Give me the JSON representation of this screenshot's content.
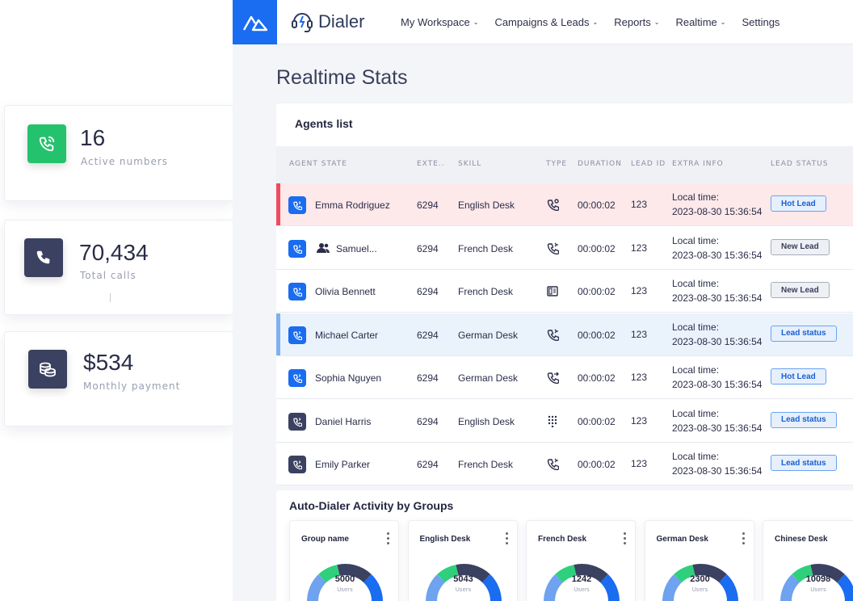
{
  "stats": [
    {
      "value": "16",
      "label": "Active numbers",
      "icon": "phone-call-icon",
      "color": "#25c26e"
    },
    {
      "value": "70,434",
      "label": "Total calls",
      "icon": "phone-icon",
      "color": "#3b4160"
    },
    {
      "value": "$534",
      "label": "Monthly payment",
      "icon": "coins-icon",
      "color": "#3b4160"
    }
  ],
  "brand": {
    "name": "Dialer",
    "accent": "#1a6cf0"
  },
  "nav": [
    {
      "label": "My Workspace",
      "dropdown": true
    },
    {
      "label": "Campaigns & Leads",
      "dropdown": true
    },
    {
      "label": "Reports",
      "dropdown": true
    },
    {
      "label": "Realtime",
      "dropdown": true
    },
    {
      "label": "Settings",
      "dropdown": false
    }
  ],
  "page_title": "Realtime Stats",
  "agents": {
    "title": "Agents list",
    "columns": [
      "AGENT STATE",
      "EXTE..",
      "SKILL",
      "TYPE",
      "DURATION",
      "LEAD ID",
      "EXTRA INFO",
      "LEAD STATUS"
    ],
    "rows": [
      {
        "name": "Emma Rodriguez",
        "ext": "6294",
        "skill": "English Desk",
        "type_icon": "phone-incoming-icon",
        "duration": "00:00:02",
        "lead_id": "123",
        "extra_label": "Local time:",
        "extra_value": "2023-08-30 15:36:54",
        "status": "Hot Lead",
        "status_style": "blue",
        "highlight": "red",
        "icon_color": "#1a6cf0"
      },
      {
        "name": "Samuel...",
        "ext": "6294",
        "skill": "French Desk",
        "type_icon": "phone-outgoing-icon",
        "duration": "00:00:02",
        "lead_id": "123",
        "extra_label": "Local time:",
        "extra_value": "2023-08-30 15:36:54",
        "status": "New Lead",
        "status_style": "gray",
        "highlight": "none",
        "icon_color": "#1a6cf0",
        "group_icon": true
      },
      {
        "name": "Olivia Bennett",
        "ext": "6294",
        "skill": "French Desk",
        "type_icon": "fax-icon",
        "duration": "00:00:02",
        "lead_id": "123",
        "extra_label": "Local time:",
        "extra_value": "2023-08-30 15:36:54",
        "status": "New Lead",
        "status_style": "gray",
        "highlight": "none",
        "icon_color": "#1a6cf0"
      },
      {
        "name": "Michael Carter",
        "ext": "6294",
        "skill": "German Desk",
        "type_icon": "phone-outgoing-icon",
        "duration": "00:00:02",
        "lead_id": "123",
        "extra_label": "Local time:",
        "extra_value": "2023-08-30 15:36:54",
        "status": "Lead status",
        "status_style": "blue",
        "highlight": "blue",
        "icon_color": "#1a6cf0"
      },
      {
        "name": "Sophia Nguyen",
        "ext": "6294",
        "skill": "German Desk",
        "type_icon": "phone-forward-icon",
        "duration": "00:00:02",
        "lead_id": "123",
        "extra_label": "Local time:",
        "extra_value": "2023-08-30 15:36:54",
        "status": "Hot Lead",
        "status_style": "blue",
        "highlight": "none",
        "icon_color": "#1a6cf0"
      },
      {
        "name": "Daniel Harris",
        "ext": "6294",
        "skill": "English Desk",
        "type_icon": "dialpad-icon",
        "duration": "00:00:02",
        "lead_id": "123",
        "extra_label": "Local time:",
        "extra_value": "2023-08-30 15:36:54",
        "status": "Lead status",
        "status_style": "blue",
        "highlight": "none",
        "icon_color": "#3b4160"
      },
      {
        "name": "Emily Parker",
        "ext": "6294",
        "skill": "French Desk",
        "type_icon": "phone-outgoing-icon",
        "duration": "00:00:02",
        "lead_id": "123",
        "extra_label": "Local time:",
        "extra_value": "2023-08-30 15:36:54",
        "status": "Lead status",
        "status_style": "blue",
        "highlight": "none",
        "icon_color": "#3b4160"
      }
    ]
  },
  "auto_dialer": {
    "title": "Auto-Dialer Activity by Groups",
    "groups": [
      {
        "name": "Group name",
        "value": "5000",
        "unit": "Users"
      },
      {
        "name": "English Desk",
        "value": "5043",
        "unit": "Users"
      },
      {
        "name": "French Desk",
        "value": "1242",
        "unit": "Users"
      },
      {
        "name": "German Desk",
        "value": "2300",
        "unit": "Users"
      },
      {
        "name": "Chinese Desk",
        "value": "10098",
        "unit": "Users"
      }
    ]
  }
}
